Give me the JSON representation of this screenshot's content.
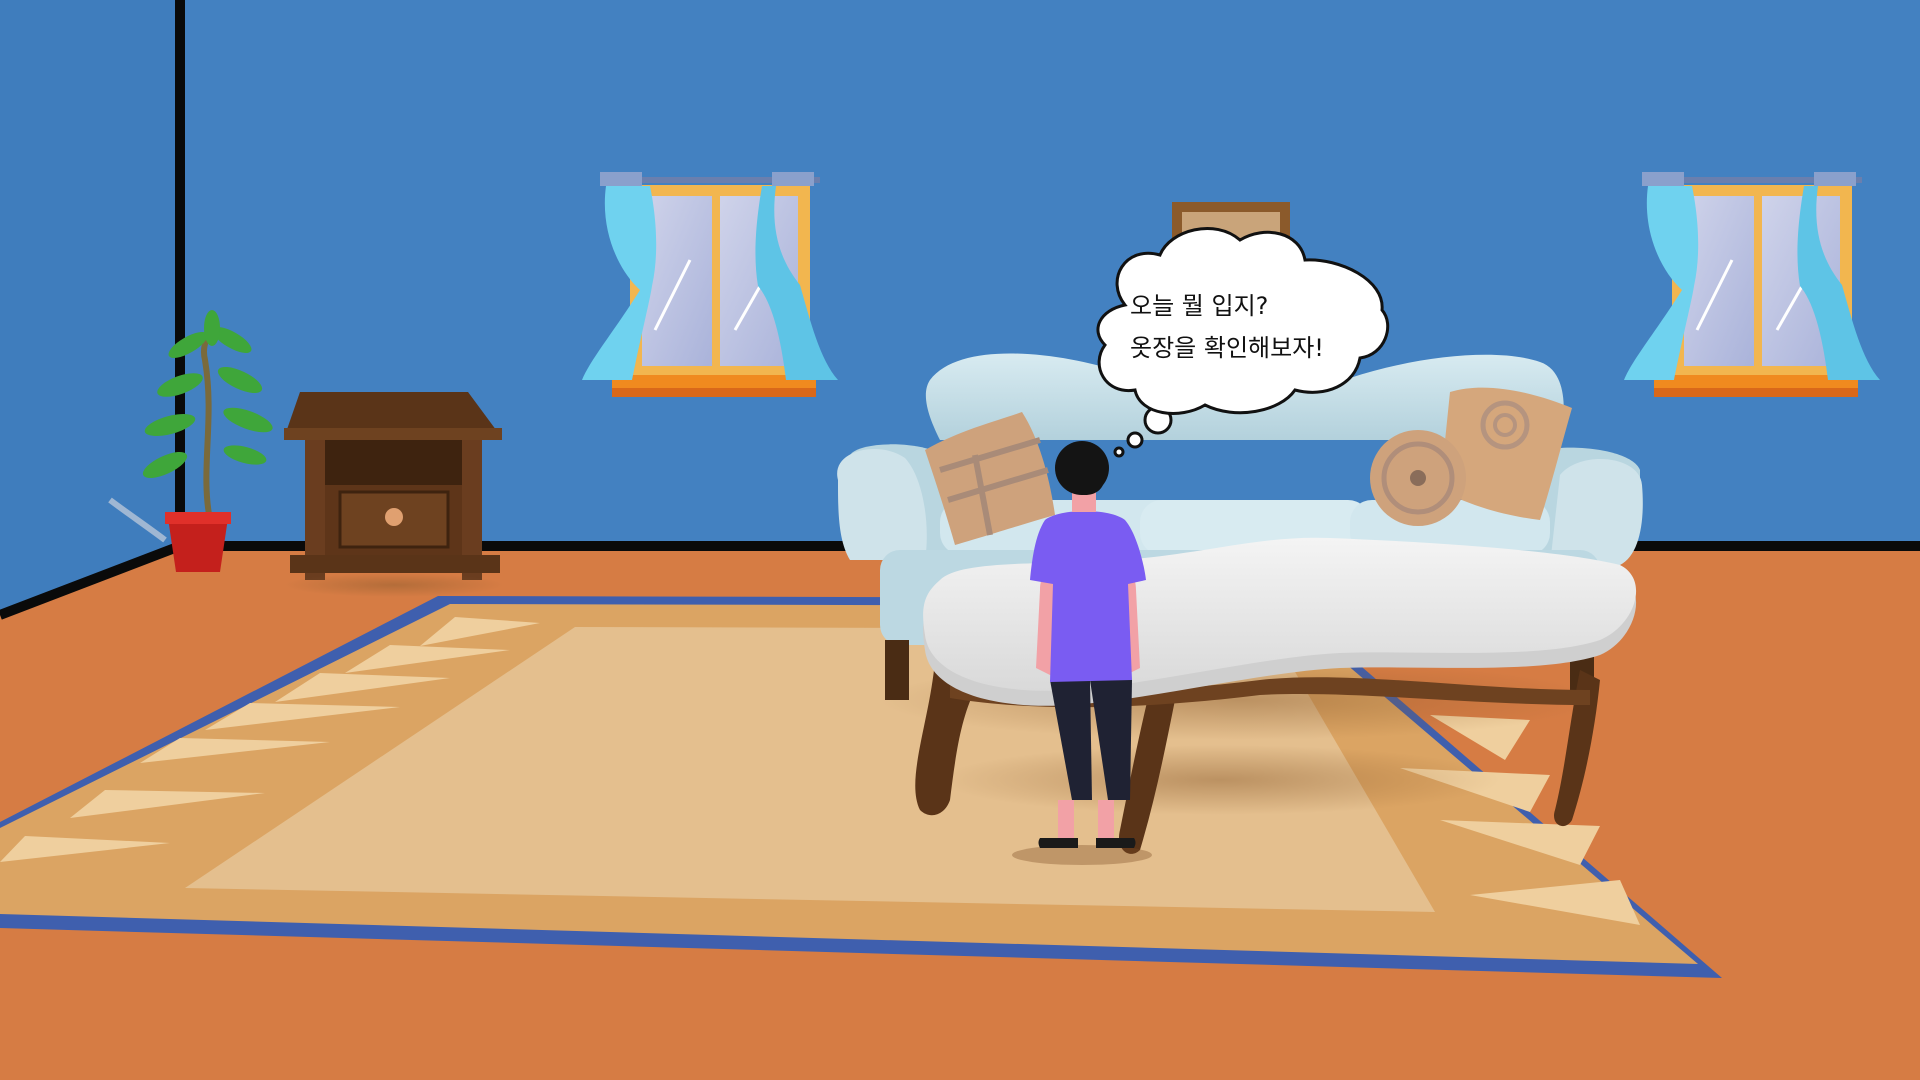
{
  "scene": {
    "speech": {
      "line1": "오늘 뭘 입지?",
      "line2": "옷장을 확인해보자!"
    }
  },
  "colors": {
    "wall": "#4381c1",
    "floor": "#d67c44",
    "rug_border": "#3f5fae",
    "rug_outer": "#dba463",
    "rug_inner": "#e4bf8e",
    "sofa": "#c6dfe8",
    "shirt": "#7a5cf2",
    "curtain": "#6fd2ef"
  }
}
